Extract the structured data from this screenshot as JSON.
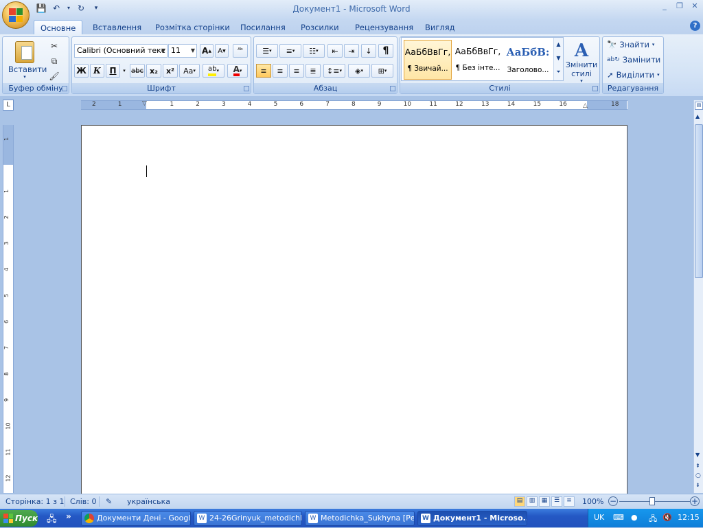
{
  "window": {
    "title": "Документ1 - Microsoft Word",
    "controls": [
      "_",
      "❐",
      "✕"
    ]
  },
  "tabs": [
    "Основне",
    "Вставлення",
    "Розмітка сторінки",
    "Посилання",
    "Розсилки",
    "Рецензування",
    "Вигляд"
  ],
  "active_tab": "Основне",
  "ribbon": {
    "clipboard": {
      "paste_label": "Вставити",
      "group_label": "Буфер обміну"
    },
    "font": {
      "font_name": "Calibri (Основний текс",
      "font_size": "11",
      "bold": "Ж",
      "italic": "К",
      "underline": "П",
      "strike": "abc",
      "subscript": "x₂",
      "superscript": "x²",
      "change_case": "Aa",
      "group_label": "Шрифт"
    },
    "paragraph": {
      "group_label": "Абзац",
      "pilcrow": "¶"
    },
    "styles": {
      "tiles": [
        {
          "preview": "АаБбВвГг,",
          "name": "¶ Звичай..."
        },
        {
          "preview": "АаБбВвГг,",
          "name": "¶ Без інте..."
        },
        {
          "preview": "АаБбВ:",
          "name": "Заголово..."
        }
      ],
      "change_styles": "Змінити стилі",
      "group_label": "Стилі"
    },
    "editing": {
      "find": "Знайти",
      "replace": "Замінити",
      "select": "Виділити",
      "group_label": "Редагування"
    }
  },
  "ruler": {
    "top_numbers": [
      "2",
      "1",
      "",
      "1",
      "2",
      "3",
      "4",
      "5",
      "6",
      "7",
      "8",
      "9",
      "10",
      "11",
      "12",
      "13",
      "14",
      "15",
      "16",
      "",
      "18"
    ],
    "left_numbers": [
      "1",
      "",
      "1",
      "2",
      "3",
      "4",
      "5",
      "6",
      "7",
      "8",
      "9",
      "10",
      "11",
      "12"
    ]
  },
  "statusbar": {
    "page": "Сторінка: 1 з 1",
    "words": "Слів: 0",
    "language": "українська",
    "zoom": "100%"
  },
  "taskbar": {
    "start": "Пуск",
    "buttons": [
      "Документи Дені - Googl...",
      "24-26Grinyuk_metodichk...",
      "Metodichka_Sukhyna [Ре...",
      "Документ1 - Microso..."
    ],
    "lang": "UK",
    "clock": "12:15"
  },
  "colors": {
    "accent": "#15428b",
    "ribbon": "#d5e4f6",
    "taskbar": "#2458c4"
  }
}
